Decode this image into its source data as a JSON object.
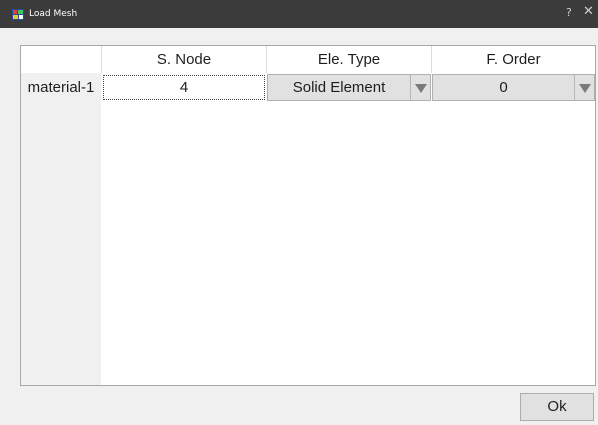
{
  "window": {
    "title": "Load Mesh",
    "help_glyph": "?",
    "close_glyph": "✕",
    "icon": "app-window-icon"
  },
  "table": {
    "columns": [
      "S. Node",
      "Ele. Type",
      "F. Order"
    ],
    "rows": [
      {
        "label": "material-1",
        "s_node": "4",
        "ele_type": "Solid Element",
        "f_order": "0"
      }
    ]
  },
  "footer": {
    "ok_label": "Ok"
  },
  "colors": {
    "titlebar": "#3b3b3b",
    "client_bg": "#f0f0f0",
    "combo_bg": "#e1e1e1"
  }
}
